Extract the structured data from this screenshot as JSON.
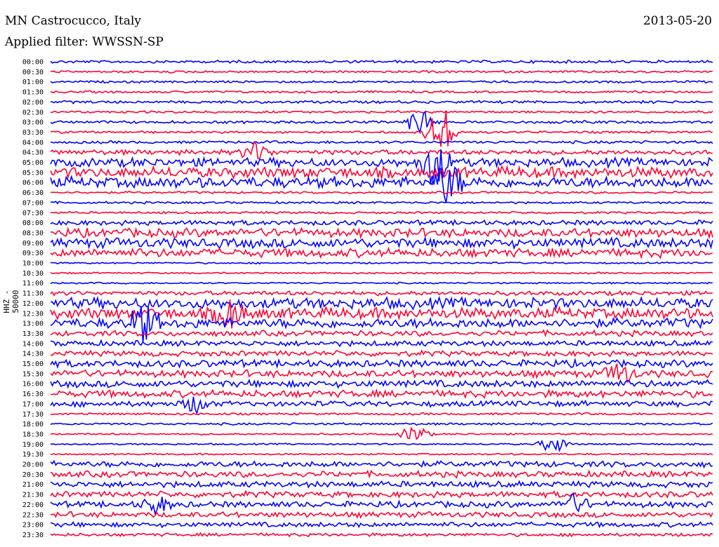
{
  "header": {
    "station": "MN Castrocucco, Italy",
    "date": "2013-05-20",
    "filter": "Applied filter: WWSSN-SP"
  },
  "chart_data": {
    "type": "line",
    "title": "MN Castrocucco, Italy",
    "ylabel": "HHZ - 50000",
    "time_labels": [
      "00:00",
      "00:30",
      "01:00",
      "01:30",
      "02:00",
      "02:30",
      "03:00",
      "03:30",
      "04:00",
      "04:30",
      "05:00",
      "05:30",
      "06:00",
      "06:30",
      "07:00",
      "07:30",
      "08:00",
      "08:30",
      "09:00",
      "09:30",
      "10:00",
      "10:30",
      "11:00",
      "11:30",
      "12:00",
      "12:30",
      "13:00",
      "13:30",
      "14:00",
      "14:30",
      "15:00",
      "15:30",
      "16:00",
      "16:30",
      "17:00",
      "17:30",
      "18:00",
      "18:30",
      "19:00",
      "19:30",
      "20:00",
      "20:30",
      "21:00",
      "21:30",
      "22:00",
      "22:30",
      "23:00",
      "23:30"
    ],
    "trace_colors": [
      "#0000ff",
      "#ff0033"
    ],
    "noise_amplitude": [
      0.5,
      0.4,
      0.4,
      0.4,
      0.5,
      0.4,
      0.5,
      0.4,
      0.5,
      0.9,
      1.6,
      2.0,
      2.0,
      0.4,
      0.4,
      0.4,
      0.9,
      1.6,
      1.8,
      1.6,
      0.3,
      0.3,
      0.3,
      0.8,
      2.0,
      2.0,
      1.8,
      1.0,
      1.0,
      1.0,
      1.3,
      1.3,
      1.3,
      1.3,
      1.0,
      0.4,
      0.4,
      0.3,
      0.3,
      0.3,
      1.1,
      1.1,
      1.1,
      1.1,
      1.1,
      1.0,
      0.9,
      0.6
    ],
    "events": [
      {
        "row": 6,
        "pos": 0.56,
        "amp": 2.2
      },
      {
        "row": 7,
        "pos": 0.59,
        "amp": 4.0
      },
      {
        "row": 9,
        "pos": 0.31,
        "amp": 1.4
      },
      {
        "row": 10,
        "pos": 0.58,
        "amp": 3.5
      },
      {
        "row": 12,
        "pos": 0.6,
        "amp": 3.0
      },
      {
        "row": 26,
        "pos": 0.14,
        "amp": 2.8
      },
      {
        "row": 25,
        "pos": 0.27,
        "amp": 2.2
      },
      {
        "row": 31,
        "pos": 0.86,
        "amp": 1.6
      },
      {
        "row": 34,
        "pos": 0.22,
        "amp": 1.2
      },
      {
        "row": 37,
        "pos": 0.55,
        "amp": 1.3
      },
      {
        "row": 38,
        "pos": 0.76,
        "amp": 1.3
      },
      {
        "row": 44,
        "pos": 0.16,
        "amp": 1.2
      },
      {
        "row": 44,
        "pos": 0.79,
        "amp": 1.3
      }
    ]
  }
}
